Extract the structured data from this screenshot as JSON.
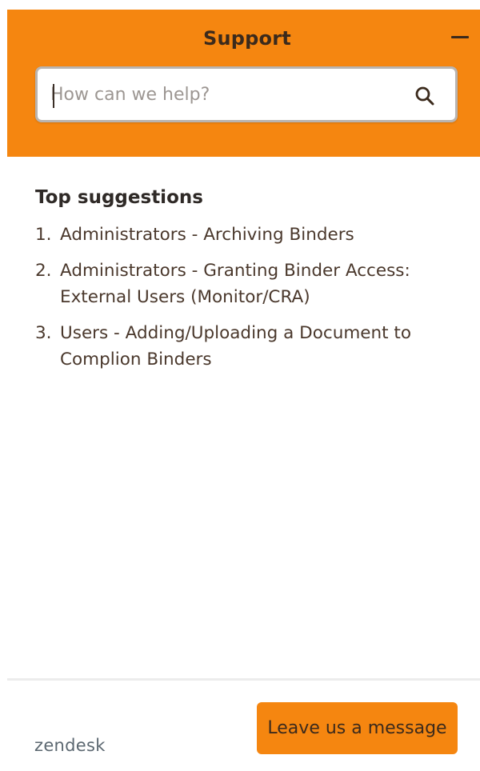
{
  "header": {
    "title": "Support",
    "minimize_icon": "minus-icon"
  },
  "search": {
    "placeholder": "How can we help?",
    "value": "",
    "icon": "search-icon"
  },
  "suggestions": {
    "title": "Top suggestions",
    "items": [
      {
        "number": "1.",
        "label": "Administrators - Archiving Binders"
      },
      {
        "number": "2.",
        "label": "Administrators - Granting Binder Access: External Users (Monitor/CRA)"
      },
      {
        "number": "3.",
        "label": "Users - Adding/Uploading a Document to Complion Binders"
      }
    ]
  },
  "footer": {
    "brand": "zendesk",
    "leave_message_label": "Leave us a message"
  },
  "colors": {
    "accent": "#f58610",
    "text": "#3b2a1c"
  }
}
